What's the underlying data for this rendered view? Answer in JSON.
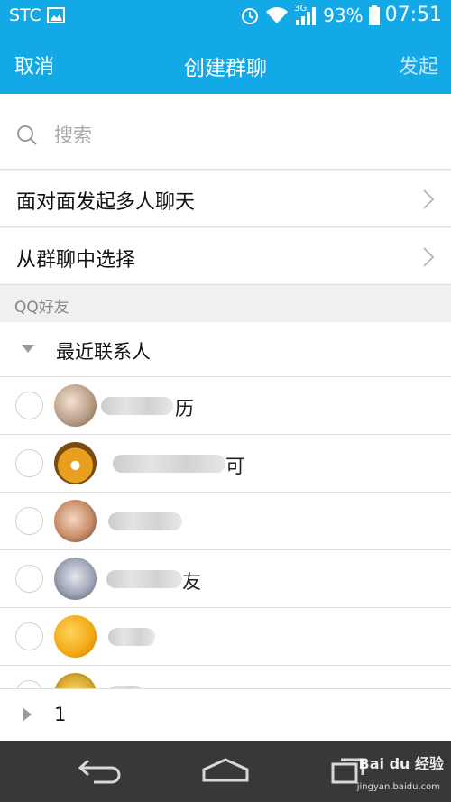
{
  "status_bar": {
    "carrier": "STC",
    "network": "3G",
    "battery": "93%",
    "time": "07:51",
    "icons": [
      "image-icon",
      "alarm-icon",
      "wifi-icon",
      "signal-icon",
      "battery-icon"
    ]
  },
  "header": {
    "cancel": "取消",
    "title": "创建群聊",
    "send": "发起"
  },
  "search": {
    "placeholder": "搜索"
  },
  "menu": [
    {
      "label": "面对面发起多人聊天"
    },
    {
      "label": "从群聊中选择"
    }
  ],
  "section": {
    "label": "QQ好友"
  },
  "group": {
    "label": "最近联系人",
    "expanded": true
  },
  "contacts": [
    {
      "name_visible": "历",
      "selected": false
    },
    {
      "name_visible": "可",
      "selected": false
    },
    {
      "name_visible": "",
      "selected": false
    },
    {
      "name_visible": "友",
      "selected": false
    },
    {
      "name_visible": "",
      "selected": false
    },
    {
      "name_visible": "",
      "selected": false
    }
  ],
  "bottom_group": {
    "label": "1",
    "expanded": false
  },
  "watermark": {
    "brand": "Bai du 经验",
    "url": "jingyan.baidu.com"
  },
  "colors": {
    "accent": "#12a9e6",
    "navbar": "#383838"
  }
}
